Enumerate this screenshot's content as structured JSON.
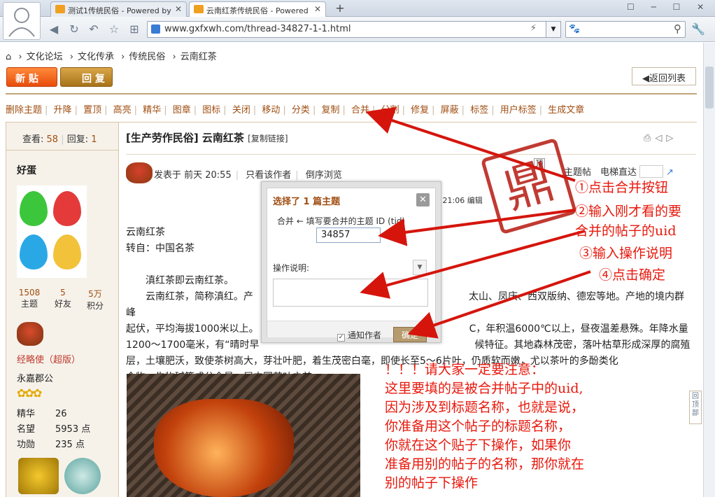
{
  "browser": {
    "tabs": [
      {
        "title": "测试1传统民俗 - Powered by"
      },
      {
        "title": "云南红茶传统民俗 - Powered"
      }
    ],
    "new_tab": "+",
    "url": "www.gxfxwh.com/thread-34827-1-1.html"
  },
  "breadcrumb": [
    "文化论坛",
    "文化传承",
    "传统民俗",
    "云南红茶"
  ],
  "buttons": {
    "new_post": "新 贴",
    "reply": "回 复",
    "back_to_list": "◀返回列表"
  },
  "mod_actions": [
    "删除主题",
    "升降",
    "置顶",
    "高亮",
    "精华",
    "图章",
    "图标",
    "关闭",
    "移动",
    "分类",
    "复制",
    "合并",
    "分割",
    "修复",
    "屏蔽",
    "标签",
    "用户标签",
    "生成文章"
  ],
  "thread": {
    "views_label": "查看:",
    "views": "58",
    "replies_label": "回复:",
    "replies": "1",
    "title": "[生产劳作民俗] 云南红茶",
    "copy_link": "[复制链接]"
  },
  "user": {
    "name": "好蛋",
    "stats": [
      {
        "value": "1508",
        "label": "主题"
      },
      {
        "value": "5",
        "label": "好友"
      },
      {
        "value": "5万",
        "label": "积分"
      }
    ],
    "rank": "经略使（超版）",
    "title": "永嘉郡公",
    "fields": [
      {
        "key": "精华",
        "value": "26"
      },
      {
        "key": "名望",
        "value": "5953 点"
      },
      {
        "key": "功勋",
        "value": "235 点"
      }
    ]
  },
  "post": {
    "posted": "发表于 前天 20:55",
    "author_only": "只看该作者",
    "reverse": "倒序浏览",
    "edit_note": "4 21:06 编辑",
    "top_badge": "顶",
    "thread_label": "主题帖",
    "floor_label": "电梯直达",
    "lines": [
      "云南红茶",
      "转自：中国名茶",
      "",
      "　　滇红茶即云南红茶。",
      "　　云南红茶，简称滇红。产　　　　　　　　　　　　　　　　　　　　　　太山、凤庆、西双版纳、德宏等地。产地的境内群峰",
      "起伏，平均海拔1000米以上。　　　　　　　　　　　　　　　　　　　　　　C，年积温6000℃以上，昼夜温差悬殊。年降水量",
      "1200～1700毫米，有“晴时早　　　　　　　　　　　　　　　　　　　　　　候特征。其地森林茂密，落叶枯草形成深厚的腐殖",
      "层，土壤肥沃，致使茶树高大，芽壮叶肥，着生茂密白毫，即使长至5～6片叶，仍质软而嫩，尤以茶叶的多酚类化",
      "合物、生物碱等成分含量，居中国茶叶之首。"
    ]
  },
  "dialog": {
    "title": "选择了 1 篇主题",
    "close": "✕",
    "merge_label": "合并 ← 填写要合并的主题 ID (tid)",
    "tid_value": "34857",
    "op_label": "操作说明:",
    "notify_label": "通知作者",
    "ok_label": "确定"
  },
  "annotations": {
    "step1": "①点击合并按钮",
    "step2a": "②输入刚才看的要",
    "step2b": "合并的帖子的uid",
    "step3": "③输入操作说明",
    "step4": "④点击确定",
    "note": [
      "！！！请大家一定要注意：",
      "这里要填的是被合并帖子中的uid,",
      "因为涉及到标题名称，也就是说，",
      "你准备用这个帖子的标题名称，",
      "你就在这个贴子下操作，如果你",
      "准备用别的帖子的名称，那你就在",
      "别的帖子下操作"
    ]
  },
  "side_button": "回顶部",
  "colors": {
    "annotation": "#e8180c",
    "link_brown": "#a04e12"
  }
}
